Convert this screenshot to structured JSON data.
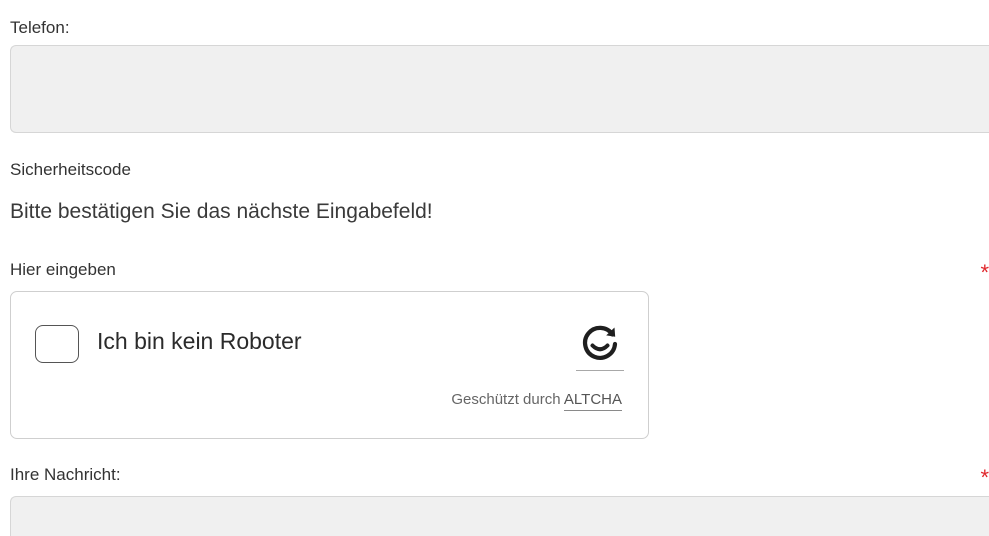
{
  "form": {
    "phone": {
      "label": "Telefon:",
      "value": ""
    },
    "security": {
      "title": "Sicherheitscode",
      "hint": "Bitte bestätigen Sie das nächste Eingabefeld!",
      "input_label": "Hier eingeben",
      "required_mark": "*",
      "captcha": {
        "checkbox_label": "Ich bin kein Roboter",
        "checked": false,
        "protected_prefix": "Geschützt durch",
        "provider_link": "ALTCHA",
        "logo_icon": "altcha-logo-icon"
      }
    },
    "message": {
      "label": "Ihre Nachricht:",
      "required_mark": "*",
      "value": ""
    }
  },
  "colors": {
    "required": "#e0262b",
    "field_bg": "#f0f0f0"
  }
}
